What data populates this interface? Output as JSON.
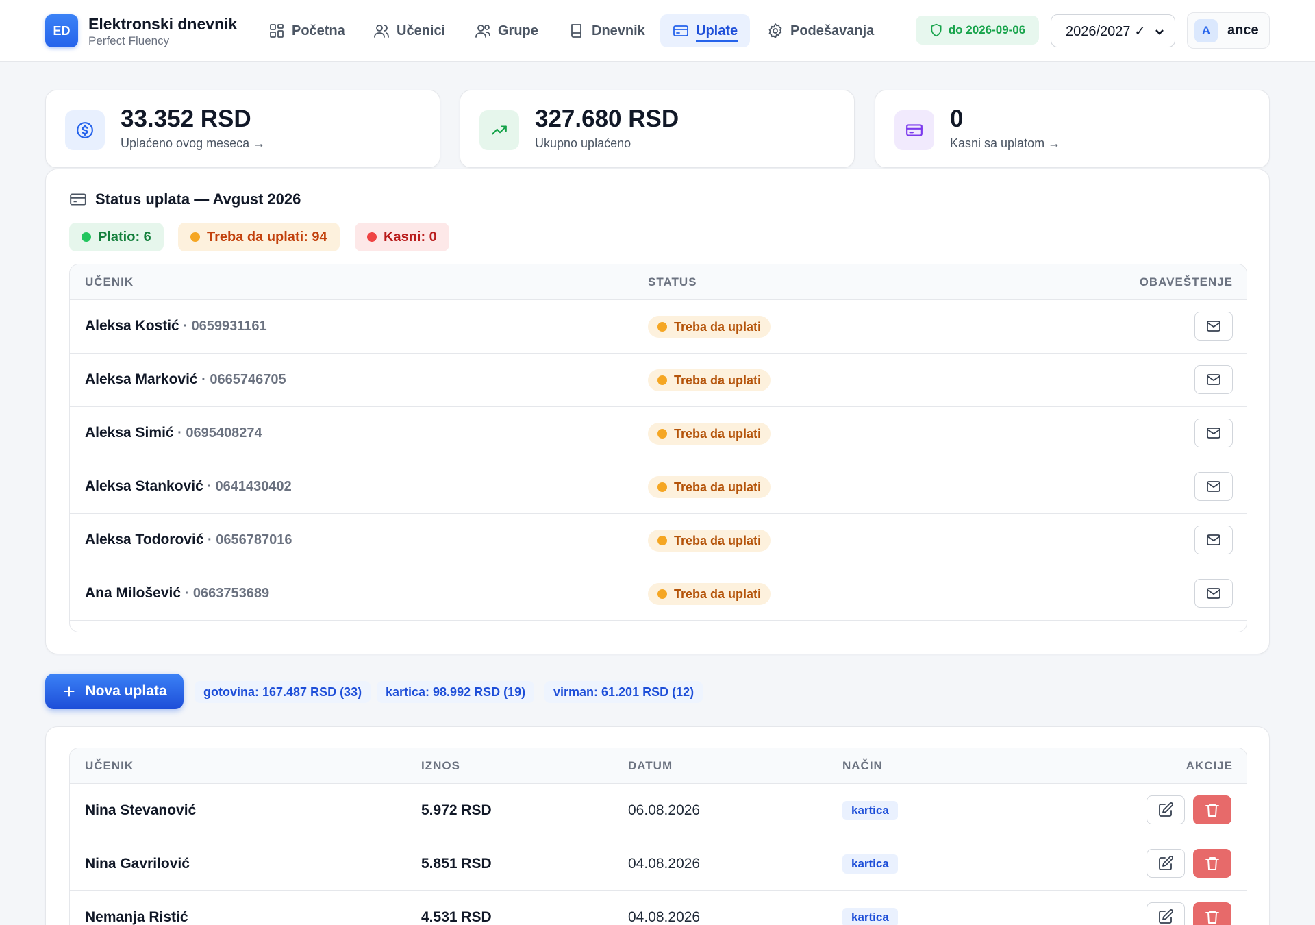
{
  "header": {
    "logo_text": "ED",
    "title": "Elektronski dnevnik",
    "subtitle": "Perfect Fluency",
    "nav": [
      {
        "label": "Početna",
        "icon": "grid-icon"
      },
      {
        "label": "Učenici",
        "icon": "users-icon"
      },
      {
        "label": "Grupe",
        "icon": "group-icon"
      },
      {
        "label": "Dnevnik",
        "icon": "book-icon"
      },
      {
        "label": "Uplate",
        "icon": "card-icon",
        "active": true
      },
      {
        "label": "Podešavanja",
        "icon": "gear-icon"
      }
    ],
    "license": "do 2026-09-06",
    "school_year": "2026/2027 ✓",
    "user_initial": "A",
    "user_name": "ance"
  },
  "stats": [
    {
      "value": "33.352 RSD",
      "label": "Uplaćeno ovog meseca →",
      "icon": "dollar-icon"
    },
    {
      "value": "327.680 RSD",
      "label": "Ukupno uplaćeno",
      "icon": "trend-up-icon"
    },
    {
      "value": "0",
      "label": "Kasni sa uplatom →",
      "icon": "credit-card-icon"
    }
  ],
  "status": {
    "title": "Status uplata — Avgust 2026",
    "pills": {
      "paid": "Platio: 6",
      "pending": "Treba da uplati: 94",
      "late": "Kasni: 0"
    },
    "columns": {
      "student": "UČENIK",
      "status": "STATUS",
      "notice": "OBAVEŠTENJE"
    },
    "rows": [
      {
        "name": "Aleksa Kostić",
        "phone": " · 0659931161",
        "status": "Treba da uplati"
      },
      {
        "name": "Aleksa Marković",
        "phone": " · 0665746705",
        "status": "Treba da uplati"
      },
      {
        "name": "Aleksa Simić",
        "phone": " · 0695408274",
        "status": "Treba da uplati"
      },
      {
        "name": "Aleksa Stanković",
        "phone": " · 0641430402",
        "status": "Treba da uplati"
      },
      {
        "name": "Aleksa Todorović",
        "phone": " · 0656787016",
        "status": "Treba da uplati"
      },
      {
        "name": "Ana Milošević",
        "phone": " · 0663753689",
        "status": "Treba da uplati"
      }
    ]
  },
  "payments": {
    "new_button": "Nova uplata",
    "summary": [
      "gotovina: 167.487 RSD (33)",
      "kartica: 98.992 RSD (19)",
      "virman: 61.201 RSD (12)"
    ],
    "columns": {
      "student": "UČENIK",
      "amount": "IZNOS",
      "date": "DATUM",
      "method": "NAČIN",
      "actions": "AKCIJE"
    },
    "rows": [
      {
        "name": "Nina Stevanović",
        "amount": "5.972 RSD",
        "date": "06.08.2026",
        "method": "kartica"
      },
      {
        "name": "Nina Gavrilović",
        "amount": "5.851 RSD",
        "date": "04.08.2026",
        "method": "kartica"
      },
      {
        "name": "Nemanja Ristić",
        "amount": "4.531 RSD",
        "date": "04.08.2026",
        "method": "kartica"
      }
    ]
  },
  "colors": {
    "accent": "#2563eb",
    "paid": "#22c55e",
    "pending": "#f5a623",
    "late": "#ef4444",
    "delete": "#e76a6a"
  }
}
